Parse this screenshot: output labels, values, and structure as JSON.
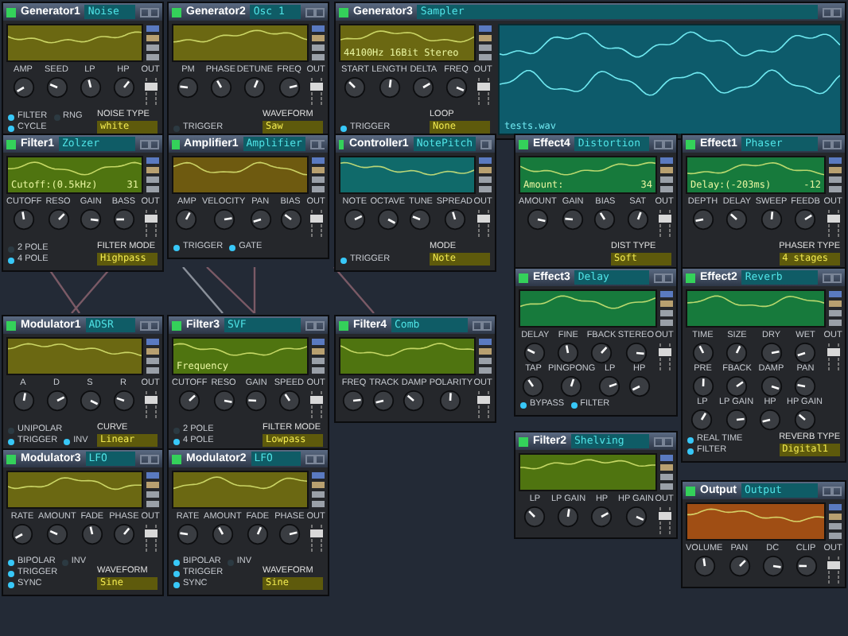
{
  "modules": [
    {
      "title": "Generator1",
      "subtitle": "Noise",
      "color": "#6b6812",
      "knob_rows": [
        [
          "AMP",
          "SEED",
          "LP",
          "HP"
        ]
      ],
      "out_label": "OUT",
      "options": [
        {
          "label": "FILTER",
          "on": true
        },
        {
          "label": "RNG",
          "on": false
        },
        {
          "label": "CYCLE",
          "on": true
        }
      ],
      "selector": {
        "label": "NOISE TYPE",
        "value": "white"
      }
    },
    {
      "title": "Generator2",
      "subtitle": "Osc 1",
      "color": "#6b6812",
      "knob_rows": [
        [
          "PM",
          "PHASE",
          "DETUNE",
          "FREQ"
        ]
      ],
      "out_label": "OUT",
      "options": [
        {
          "label": "TRIGGER",
          "on": false
        }
      ],
      "selector": {
        "label": "WAVEFORM",
        "value": "Saw"
      }
    },
    {
      "title": "Generator3",
      "subtitle": "Sampler",
      "color": "#6b6812",
      "display_text": "44100Hz 16Bit Stereo",
      "sample": {
        "file": "tests.wav"
      },
      "knob_rows": [
        [
          "START",
          "LENGTH",
          "DELTA",
          "FREQ"
        ]
      ],
      "out_label": "OUT",
      "options": [
        {
          "label": "TRIGGER",
          "on": true
        }
      ],
      "selector": {
        "label": "LOOP",
        "value": "None"
      }
    },
    {
      "title": "Filter1",
      "subtitle": "Zolzer",
      "color": "#4f7410",
      "display_text": "Cutoff:(0.5kHz)",
      "reading": "31",
      "knob_rows": [
        [
          "CUTOFF",
          "RESO",
          "GAIN",
          "BASS"
        ]
      ],
      "out_label": "OUT",
      "options": [
        {
          "label": "2 POLE",
          "on": false
        },
        {
          "label": "4 POLE",
          "on": true
        }
      ],
      "selector": {
        "label": "FILTER MODE",
        "value": "Highpass"
      }
    },
    {
      "title": "Amplifier1",
      "subtitle": "Amplifier",
      "color": "#6e5a10",
      "knob_rows": [
        [
          "AMP",
          "VELOCITY",
          "PAN",
          "BIAS"
        ]
      ],
      "out_label": "OUT",
      "options": [
        {
          "label": "TRIGGER",
          "on": true
        },
        {
          "label": "GATE",
          "on": true
        }
      ]
    },
    {
      "title": "Controller1",
      "subtitle": "NotePitch",
      "color": "#106a6a",
      "knob_rows": [
        [
          "NOTE",
          "OCTAVE",
          "TUNE",
          "SPREAD"
        ]
      ],
      "out_label": "OUT",
      "options": [
        {
          "label": "TRIGGER",
          "on": true
        }
      ],
      "selector": {
        "label": "MODE",
        "value": "Note"
      }
    },
    {
      "title": "Effect4",
      "subtitle": "Distortion",
      "color": "#177a3c",
      "display_text": "Amount:",
      "reading": "34",
      "knob_rows": [
        [
          "AMOUNT",
          "GAIN",
          "BIAS",
          "SAT"
        ]
      ],
      "out_label": "OUT",
      "selector": {
        "label": "DIST TYPE",
        "value": "Soft"
      }
    },
    {
      "title": "Effect1",
      "subtitle": "Phaser",
      "color": "#177a3c",
      "display_text": "Delay:(-203ms)",
      "reading": "-12",
      "knob_rows": [
        [
          "DEPTH",
          "DELAY",
          "SWEEP",
          "FEEDB"
        ]
      ],
      "out_label": "OUT",
      "selector": {
        "label": "PHASER TYPE",
        "value": "4 stages"
      }
    },
    {
      "title": "Effect3",
      "subtitle": "Delay",
      "color": "#177a3c",
      "knob_rows": [
        [
          "DELAY",
          "FINE",
          "FBACK",
          "STEREO"
        ],
        [
          "TAP",
          "PINGPONG",
          "LP",
          "HP"
        ]
      ],
      "out_label": "OUT",
      "options": [
        {
          "label": "BYPASS",
          "on": true
        },
        {
          "label": "FILTER",
          "on": true
        }
      ]
    },
    {
      "title": "Effect2",
      "subtitle": "Reverb",
      "color": "#177a3c",
      "knob_rows": [
        [
          "TIME",
          "SIZE",
          "DRY",
          "WET"
        ],
        [
          "PRE",
          "FBACK",
          "DAMP",
          "PAN"
        ],
        [
          "LP",
          "LP GAIN",
          "HP",
          "HP GAIN"
        ]
      ],
      "out_label": "OUT",
      "options": [
        {
          "label": "REAL TIME",
          "on": true
        },
        {
          "label": "FILTER",
          "on": true
        }
      ],
      "selector": {
        "label": "REVERB TYPE",
        "value": "Digital1"
      }
    },
    {
      "title": "Modulator1",
      "subtitle": "ADSR",
      "color": "#6b6812",
      "knob_rows": [
        [
          "A",
          "D",
          "S",
          "R"
        ]
      ],
      "out_label": "OUT",
      "options": [
        {
          "label": "UNIPOLAR",
          "on": false
        },
        {
          "label": "TRIGGER",
          "on": true
        },
        {
          "label": "INV",
          "on": true
        }
      ],
      "selector": {
        "label": "CURVE",
        "value": "Linear"
      }
    },
    {
      "title": "Filter3",
      "subtitle": "SVF",
      "color": "#4f7410",
      "display_text": "Frequency",
      "knob_rows": [
        [
          "CUTOFF",
          "RESO",
          "GAIN",
          "SPEED"
        ]
      ],
      "out_label": "OUT",
      "options": [
        {
          "label": "2 POLE",
          "on": false
        },
        {
          "label": "4 POLE",
          "on": true
        }
      ],
      "selector": {
        "label": "FILTER MODE",
        "value": "Lowpass"
      }
    },
    {
      "title": "Filter4",
      "subtitle": "Comb",
      "color": "#4f7410",
      "knob_rows": [
        [
          "FREQ",
          "TRACK",
          "DAMP",
          "POLARITY"
        ]
      ],
      "out_label": "OUT"
    },
    {
      "title": "Modulator3",
      "subtitle": "LFO",
      "color": "#6b6812",
      "knob_rows": [
        [
          "RATE",
          "AMOUNT",
          "FADE",
          "PHASE"
        ]
      ],
      "out_label": "OUT",
      "options": [
        {
          "label": "BIPOLAR",
          "on": true
        },
        {
          "label": "INV",
          "on": false
        },
        {
          "label": "TRIGGER",
          "on": true
        },
        {
          "label": "SYNC",
          "on": true
        }
      ],
      "selector": {
        "label": "WAVEFORM",
        "value": "Sine"
      }
    },
    {
      "title": "Modulator2",
      "subtitle": "LFO",
      "color": "#6b6812",
      "knob_rows": [
        [
          "RATE",
          "AMOUNT",
          "FADE",
          "PHASE"
        ]
      ],
      "out_label": "OUT",
      "options": [
        {
          "label": "BIPOLAR",
          "on": true
        },
        {
          "label": "INV",
          "on": false
        },
        {
          "label": "TRIGGER",
          "on": true
        },
        {
          "label": "SYNC",
          "on": true
        }
      ],
      "selector": {
        "label": "WAVEFORM",
        "value": "Sine"
      }
    },
    {
      "title": "Filter2",
      "subtitle": "Shelving",
      "color": "#4f7410",
      "knob_rows": [
        [
          "LP",
          "LP GAIN",
          "HP",
          "HP GAIN"
        ]
      ],
      "out_label": "OUT"
    },
    {
      "title": "Output",
      "subtitle": "Output",
      "color": "#a04e14",
      "knob_rows": [
        [
          "VOLUME",
          "PAN",
          "DC",
          "CLIP"
        ]
      ],
      "out_label": "OUT"
    }
  ]
}
